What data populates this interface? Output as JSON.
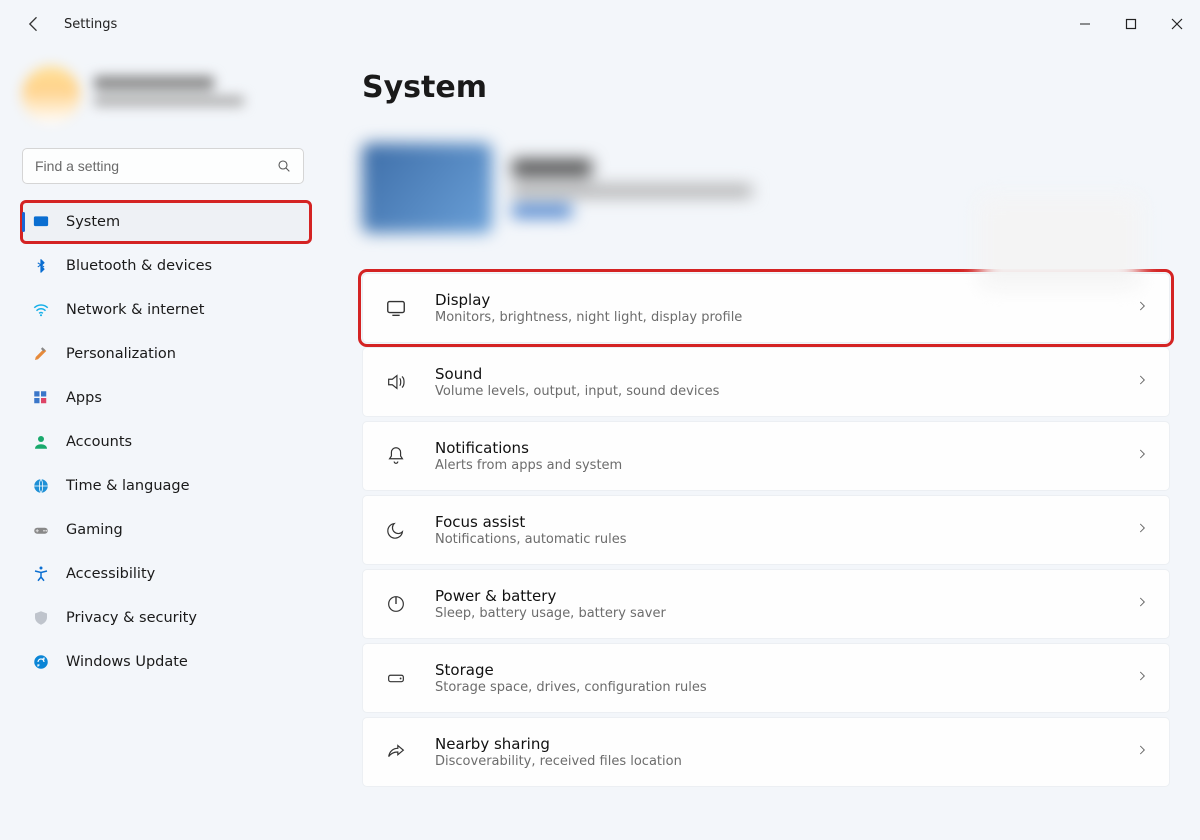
{
  "window_title": "Settings",
  "search": {
    "placeholder": "Find a setting"
  },
  "page_heading": "System",
  "sidebar": {
    "items": [
      {
        "id": "system",
        "label": "System",
        "selected": true,
        "highlight": true,
        "icon": "system-icon"
      },
      {
        "id": "bluetooth",
        "label": "Bluetooth & devices",
        "selected": false,
        "highlight": false,
        "icon": "bluetooth-icon"
      },
      {
        "id": "network",
        "label": "Network & internet",
        "selected": false,
        "highlight": false,
        "icon": "wifi-icon"
      },
      {
        "id": "personalization",
        "label": "Personalization",
        "selected": false,
        "highlight": false,
        "icon": "paintbrush-icon"
      },
      {
        "id": "apps",
        "label": "Apps",
        "selected": false,
        "highlight": false,
        "icon": "apps-icon"
      },
      {
        "id": "accounts",
        "label": "Accounts",
        "selected": false,
        "highlight": false,
        "icon": "person-icon"
      },
      {
        "id": "time",
        "label": "Time & language",
        "selected": false,
        "highlight": false,
        "icon": "globe-icon"
      },
      {
        "id": "gaming",
        "label": "Gaming",
        "selected": false,
        "highlight": false,
        "icon": "gamepad-icon"
      },
      {
        "id": "accessibility",
        "label": "Accessibility",
        "selected": false,
        "highlight": false,
        "icon": "accessibility-icon"
      },
      {
        "id": "privacy",
        "label": "Privacy & security",
        "selected": false,
        "highlight": false,
        "icon": "shield-icon"
      },
      {
        "id": "update",
        "label": "Windows Update",
        "selected": false,
        "highlight": false,
        "icon": "update-icon"
      }
    ]
  },
  "settings_cards": [
    {
      "id": "display",
      "title": "Display",
      "subtitle": "Monitors, brightness, night light, display profile",
      "icon": "monitor-icon",
      "highlight": true
    },
    {
      "id": "sound",
      "title": "Sound",
      "subtitle": "Volume levels, output, input, sound devices",
      "icon": "speaker-icon",
      "highlight": false
    },
    {
      "id": "notifications",
      "title": "Notifications",
      "subtitle": "Alerts from apps and system",
      "icon": "bell-icon",
      "highlight": false
    },
    {
      "id": "focus",
      "title": "Focus assist",
      "subtitle": "Notifications, automatic rules",
      "icon": "moon-icon",
      "highlight": false
    },
    {
      "id": "power",
      "title": "Power & battery",
      "subtitle": "Sleep, battery usage, battery saver",
      "icon": "power-icon",
      "highlight": false
    },
    {
      "id": "storage",
      "title": "Storage",
      "subtitle": "Storage space, drives, configuration rules",
      "icon": "drive-icon",
      "highlight": false
    },
    {
      "id": "nearby",
      "title": "Nearby sharing",
      "subtitle": "Discoverability, received files location",
      "icon": "share-icon",
      "highlight": false
    }
  ]
}
